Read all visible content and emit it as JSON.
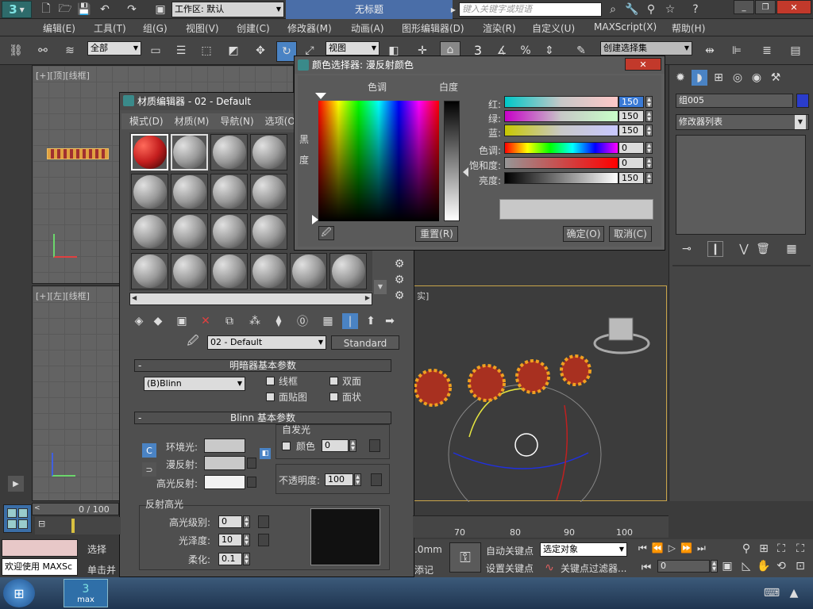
{
  "titlebar": {
    "workspace": "工作区: 默认",
    "doc_title": "无标题",
    "search_placeholder": "键入关键字或短语"
  },
  "menu": [
    "编辑(E)",
    "工具(T)",
    "组(G)",
    "视图(V)",
    "创建(C)",
    "修改器(M)",
    "动画(A)",
    "图形编辑器(D)",
    "渲染(R)",
    "自定义(U)",
    "MAXScript(X)",
    "帮助(H)"
  ],
  "toolbar": {
    "selection_filter": "全部",
    "ref_coord": "视图",
    "named_selection": "创建选择集",
    "snap_num": "3"
  },
  "viewports": {
    "top_label": "[+][顶][线框]",
    "left_label": "[+][左][线框]",
    "persp_label": "实]"
  },
  "material_editor": {
    "title": "材质编辑器 - 02 - Default",
    "menu": [
      "模式(D)",
      "材质(M)",
      "导航(N)",
      "选项(O"
    ],
    "material_name": "02 - Default",
    "material_type": "Standard",
    "shader_rollout": "明暗器基本参数",
    "shader": "(B)Blinn",
    "wire": "线框",
    "two_sided": "双面",
    "face_map": "面贴图",
    "faceted": "面状",
    "blinn_rollout": "Blinn 基本参数",
    "self_illum": "自发光",
    "color_label": "颜色",
    "self_illum_value": "0",
    "ambient": "环境光:",
    "diffuse": "漫反射:",
    "specular": "高光反射:",
    "opacity_label": "不透明度:",
    "opacity": "100",
    "spec_hl": "反射高光",
    "spec_level_label": "高光级别:",
    "spec_level": "0",
    "gloss_label": "光泽度:",
    "gloss": "10",
    "soften_label": "柔化:",
    "soften": "0.1"
  },
  "color_picker": {
    "title": "颜色选择器: 漫反射颜色",
    "hue_header": "色调",
    "white_header": "白度",
    "black_label": "黑",
    "black_label2": "度",
    "red_label": "红:",
    "green_label": "绿:",
    "blue_label": "蓝:",
    "hue_label": "色调:",
    "sat_label": "饱和度:",
    "val_label": "亮度:",
    "red": "150",
    "green": "150",
    "blue": "150",
    "hue": "0",
    "sat": "0",
    "value": "150",
    "reset": "重置(R)",
    "ok": "确定(O)",
    "cancel": "取消(C)",
    "preview_color": "#969696"
  },
  "command_panel": {
    "object_name": "组005",
    "modifier_list": "修改器列表",
    "object_color": "#2a3ccc"
  },
  "bottom": {
    "frame": "0 / 100",
    "ruler": [
      "70",
      "80",
      "90",
      "100"
    ],
    "welcome": "欢迎使用 MAXSc",
    "select_short": "选择",
    "single_click": "单击并",
    "auto_key": "自动关键点",
    "set_key": "设置关键点",
    "selected_obj": "选定对象",
    "key_filters": "关键点过滤器...",
    "frame_field": "0",
    "mm": ".0mm",
    "add_marker": "添记"
  },
  "taskbar": {
    "app": "max"
  }
}
